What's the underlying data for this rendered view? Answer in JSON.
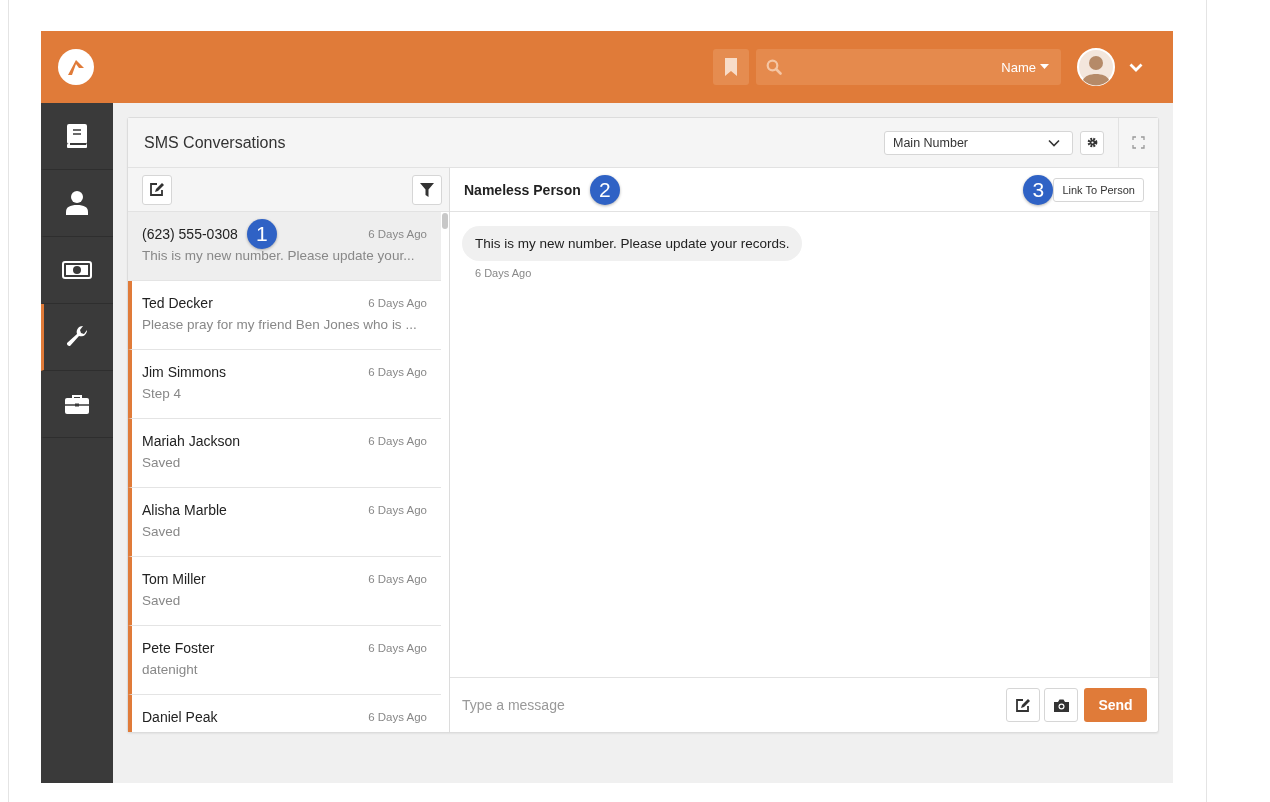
{
  "header": {
    "search": {
      "scope": "Name"
    }
  },
  "sidebar": {
    "items": [
      {
        "kind": "book",
        "selected": false
      },
      {
        "kind": "person",
        "selected": false
      },
      {
        "kind": "money",
        "selected": false
      },
      {
        "kind": "wrench",
        "selected": true
      },
      {
        "kind": "briefcase",
        "selected": false
      }
    ]
  },
  "panel": {
    "title": "SMS Conversations",
    "number_select": {
      "value": "Main Number"
    }
  },
  "conversations": [
    {
      "name": "(623) 555-0308",
      "time": "6 Days Ago",
      "preview": "This is my new number. Please update your...",
      "selected": true,
      "unread": false,
      "callout": "1"
    },
    {
      "name": "Ted Decker",
      "time": "6 Days Ago",
      "preview": "Please pray for my friend Ben Jones who is ...",
      "selected": false,
      "unread": true
    },
    {
      "name": "Jim Simmons",
      "time": "6 Days Ago",
      "preview": "Step 4",
      "selected": false,
      "unread": true
    },
    {
      "name": "Mariah Jackson",
      "time": "6 Days Ago",
      "preview": "Saved",
      "selected": false,
      "unread": true
    },
    {
      "name": "Alisha Marble",
      "time": "6 Days Ago",
      "preview": "Saved",
      "selected": false,
      "unread": true
    },
    {
      "name": "Tom Miller",
      "time": "6 Days Ago",
      "preview": "Saved",
      "selected": false,
      "unread": true
    },
    {
      "name": "Pete Foster",
      "time": "6 Days Ago",
      "preview": "datenight",
      "selected": false,
      "unread": true
    },
    {
      "name": "Daniel Peak",
      "time": "6 Days Ago",
      "selected": false,
      "unread": true
    }
  ],
  "chat": {
    "name": "Nameless Person",
    "name_callout": "2",
    "link_callout": "3",
    "link_button": "Link To Person",
    "messages": [
      {
        "text": "This is my new number. Please update your records.",
        "time": "6 Days Ago"
      }
    ],
    "composer": {
      "placeholder": "Type a message",
      "send": "Send"
    }
  }
}
